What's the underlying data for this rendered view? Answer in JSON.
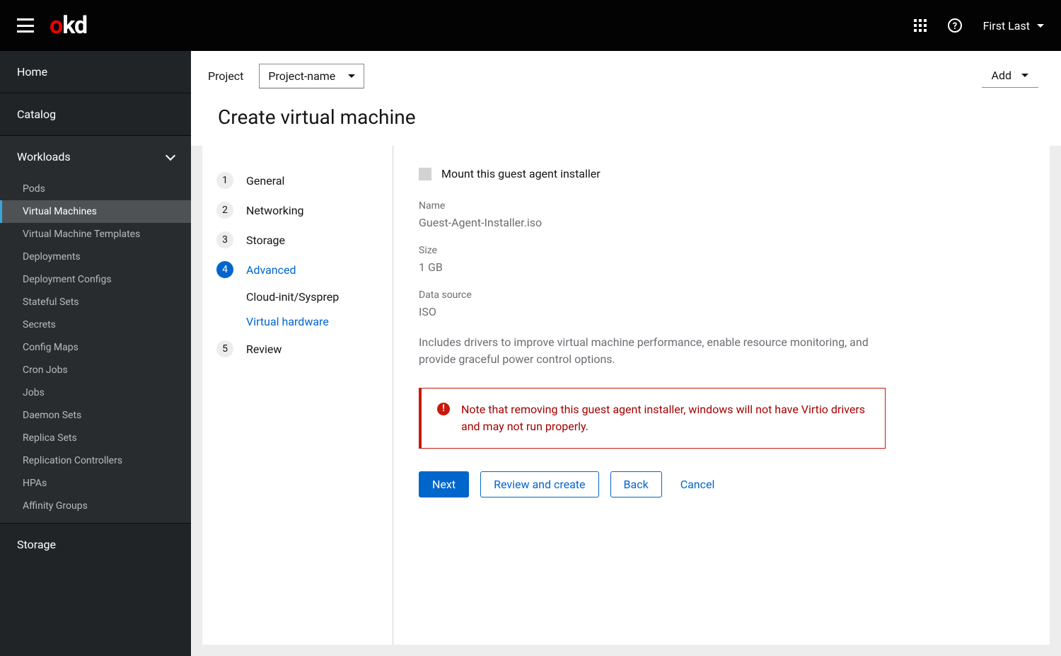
{
  "masthead": {
    "logo_part1": "o",
    "logo_part2": "kd",
    "user_name": "First Last"
  },
  "sidebar": {
    "items": [
      {
        "label": "Home"
      },
      {
        "label": "Catalog"
      },
      {
        "label": "Workloads",
        "expanded": true,
        "children": [
          {
            "label": "Pods"
          },
          {
            "label": "Virtual Machines",
            "active": true
          },
          {
            "label": "Virtual Machine Templates"
          },
          {
            "label": "Deployments"
          },
          {
            "label": "Deployment Configs"
          },
          {
            "label": "Stateful Sets"
          },
          {
            "label": "Secrets"
          },
          {
            "label": "Config Maps"
          },
          {
            "label": "Cron Jobs"
          },
          {
            "label": "Jobs"
          },
          {
            "label": "Daemon Sets"
          },
          {
            "label": "Replica Sets"
          },
          {
            "label": "Replication Controllers"
          },
          {
            "label": "HPAs"
          },
          {
            "label": "Affinity Groups"
          }
        ]
      },
      {
        "label": "Storage"
      }
    ]
  },
  "header": {
    "project_label": "Project",
    "project_value": "Project-name",
    "add_label": "Add",
    "page_title": "Create virtual machine"
  },
  "wizard": {
    "steps": [
      {
        "num": "1",
        "label": "General"
      },
      {
        "num": "2",
        "label": "Networking"
      },
      {
        "num": "3",
        "label": "Storage"
      },
      {
        "num": "4",
        "label": "Advanced",
        "active": true,
        "children": [
          {
            "label": "Cloud-init/Sysprep"
          },
          {
            "label": "Virtual hardware",
            "active": true
          }
        ]
      },
      {
        "num": "5",
        "label": "Review"
      }
    ]
  },
  "form": {
    "checkbox_label": "Mount this guest agent installer",
    "name_label": "Name",
    "name_value": "Guest-Agent-Installer.iso",
    "size_label": "Size",
    "size_value": "1 GB",
    "source_label": "Data source",
    "source_value": "ISO",
    "description": "Includes drivers to improve virtual machine performance, enable resource monitoring, and provide graceful power control options.",
    "alert_text": "Note that removing this guest agent installer, windows will not have Virtio drivers and may not run properly."
  },
  "buttons": {
    "next": "Next",
    "review": "Review and create",
    "back": "Back",
    "cancel": "Cancel"
  }
}
